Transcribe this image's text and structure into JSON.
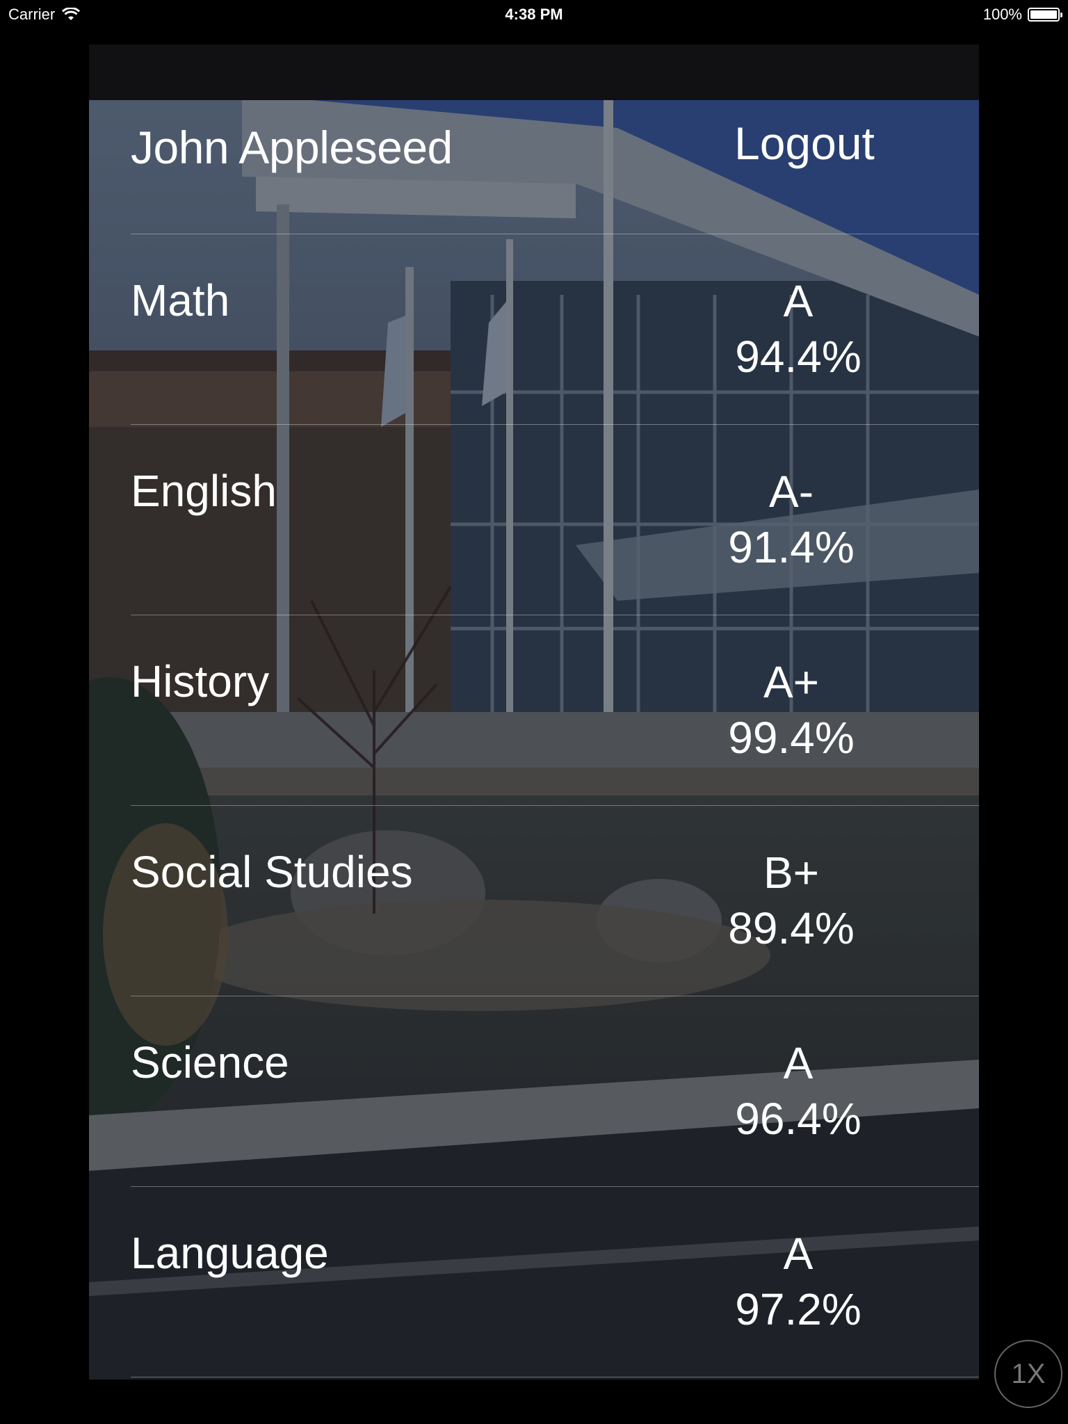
{
  "status_bar": {
    "carrier": "Carrier",
    "time": "4:38 PM",
    "battery": "100%"
  },
  "header": {
    "user_name": "John Appleseed",
    "logout_label": "Logout"
  },
  "grades": [
    {
      "subject": "Math",
      "letter": "A",
      "percent": "94.4%"
    },
    {
      "subject": "English",
      "letter": "A-",
      "percent": "91.4%"
    },
    {
      "subject": "History",
      "letter": "A+",
      "percent": "99.4%"
    },
    {
      "subject": "Social Studies",
      "letter": "B+",
      "percent": "89.4%"
    },
    {
      "subject": "Science",
      "letter": "A",
      "percent": "96.4%"
    },
    {
      "subject": "Language",
      "letter": "A",
      "percent": "97.2%"
    }
  ],
  "zoom_label": "1X",
  "icons": {
    "wifi": "wifi-icon",
    "battery": "battery-icon"
  }
}
